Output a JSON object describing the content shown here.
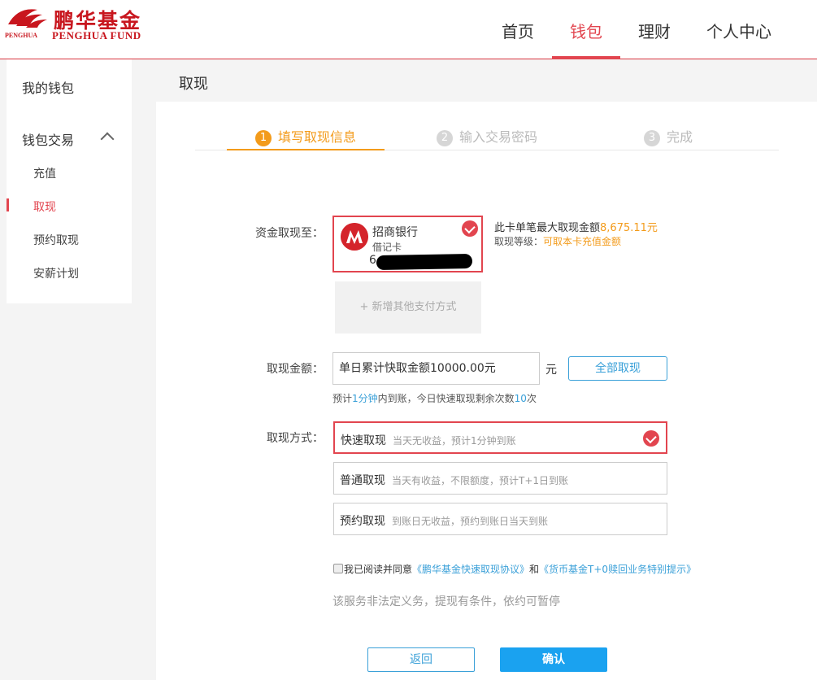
{
  "brand": {
    "name_cn": "鹏华基金",
    "name_en": "PENGHUA FUND",
    "name_en_small": "PENGHUA",
    "color": "#c8161e"
  },
  "nav": {
    "items": [
      "首页",
      "钱包",
      "理财",
      "个人中心"
    ],
    "active": "钱包"
  },
  "sidebar": {
    "title": "我的钱包",
    "group": "钱包交易",
    "items": [
      "充值",
      "取现",
      "预约取现",
      "安薪计划"
    ],
    "active": "取现"
  },
  "page": {
    "title": "取现"
  },
  "steps": [
    {
      "num": "1",
      "label": "填写取现信息"
    },
    {
      "num": "2",
      "label": "输入交易密码"
    },
    {
      "num": "3",
      "label": "完成"
    }
  ],
  "card_section": {
    "label": "资金取现至：",
    "bank_name": "招商银行",
    "card_type": "借记卡",
    "card_no_prefix": "6",
    "max_text": "此卡单笔最大取现金额",
    "max_amount": "8,675.11元",
    "level_text": "取现等级：",
    "level_value": "可取本卡充值金额",
    "add_payment": "+ 新增其他支付方式"
  },
  "amount_section": {
    "label": "取现金额：",
    "input_value": "单日累计快取金额10000.00元",
    "unit": "元",
    "all_button": "全部取现",
    "hint_pre": "预计",
    "hint_time": "1分钟",
    "hint_mid": "内到账，今日快速取现剩余次数",
    "hint_count": "10",
    "hint_post": "次"
  },
  "method_section": {
    "label": "取现方式：",
    "methods": [
      {
        "name": "快速取现",
        "desc": "当天无收益，预计1分钟到账",
        "selected": true
      },
      {
        "name": "普通取现",
        "desc": "当天有收益，不限额度，预计T+1日到账",
        "selected": false
      },
      {
        "name": "预约取现",
        "desc": "到账日无收益，预约到账日当天到账",
        "selected": false
      }
    ]
  },
  "agreement": {
    "text": "我已阅读并同意",
    "link1": "《鹏华基金快速取现协议》",
    "and": "和",
    "link2": "《货币基金T+0赎回业务特别提示》"
  },
  "notice": "该服务非法定义务，提现有条件，依约可暂停",
  "buttons": {
    "back": "返回",
    "confirm": "确认"
  },
  "colors": {
    "accent_red": "#e2454f",
    "step_orange": "#f39b1b",
    "link_blue": "#3aa0d8",
    "confirm_blue": "#1aa2f0"
  }
}
